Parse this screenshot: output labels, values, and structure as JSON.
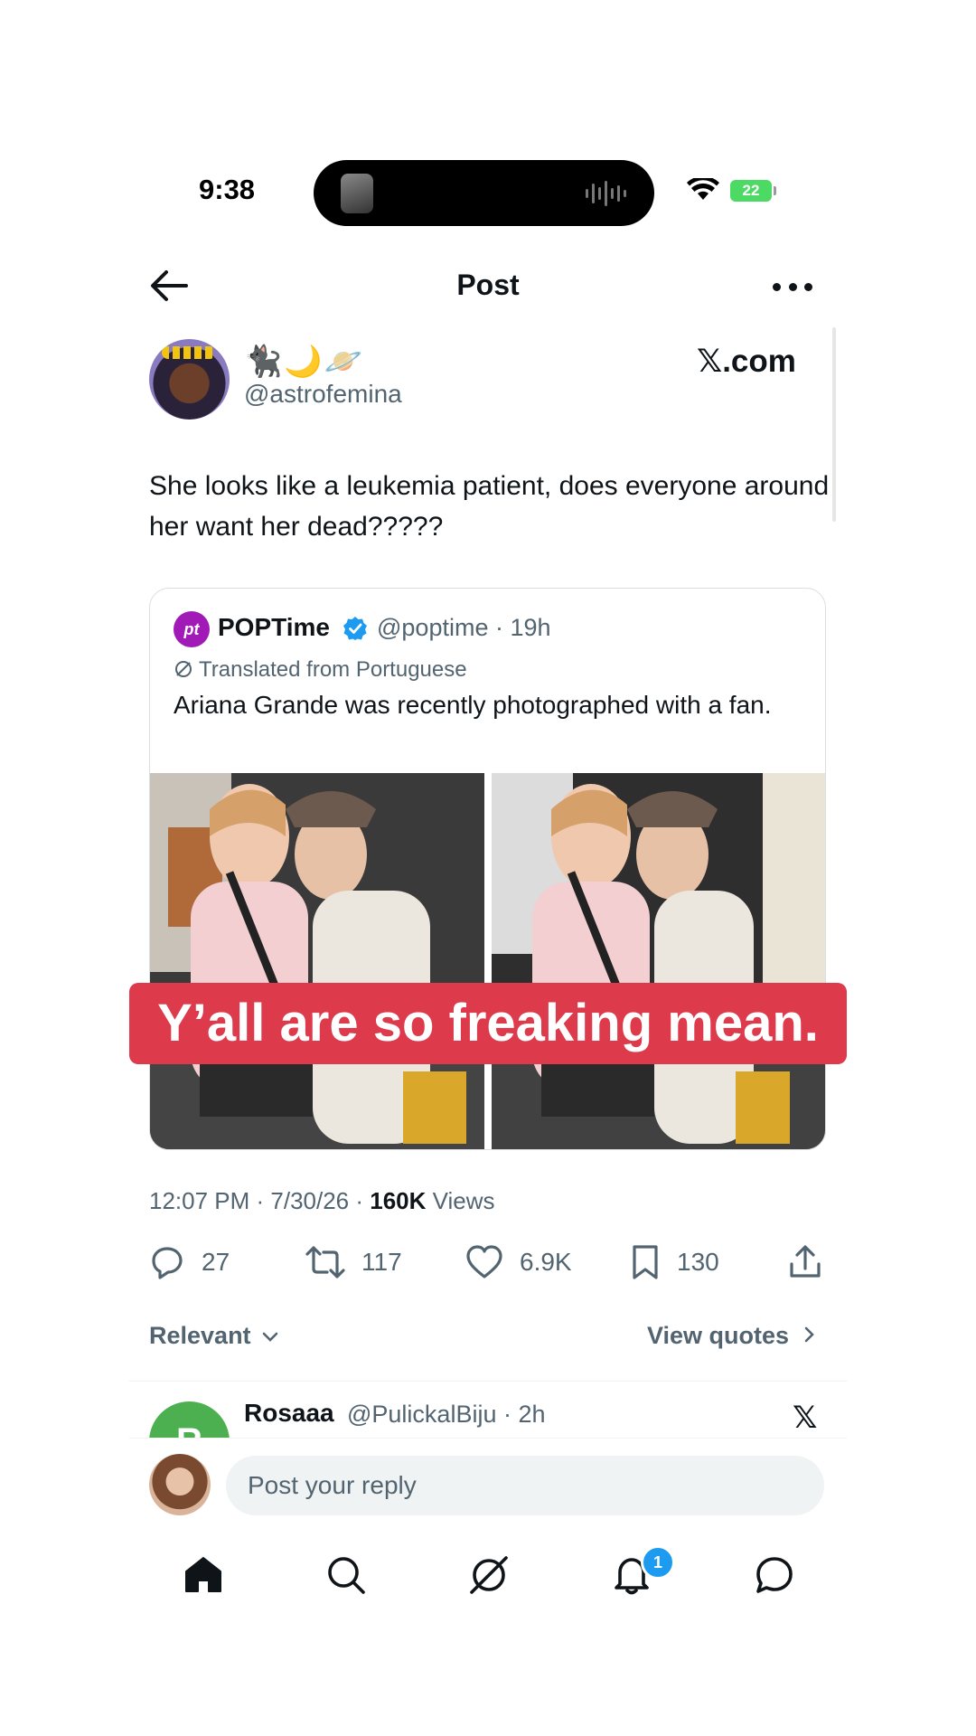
{
  "status_bar": {
    "time": "9:38",
    "battery": "22"
  },
  "header": {
    "title": "Post"
  },
  "post": {
    "author_name": "🐈‍⬛🌙🪐",
    "author_handle": "@astrofemina",
    "source": "𝕏.com",
    "text": "She looks like a leukemia patient, does everyone around her want her dead?????",
    "timestamp": "12:07 PM · 7/30/26 · ",
    "views_count": "160K",
    "views_label": " Views",
    "stats": {
      "replies": "27",
      "reposts": "117",
      "likes": "6.9K",
      "bookmarks": "130"
    }
  },
  "quote": {
    "logo_text": "pt",
    "name": "POPTime",
    "meta": "@poptime · 19h",
    "translated": "Translated from Portuguese",
    "text": "Ariana Grande was recently photographed with a fan."
  },
  "caption": "Y’all are so freaking mean.",
  "sort": {
    "relevant_label": "Relevant",
    "view_quotes_label": "View quotes"
  },
  "reply_preview": {
    "avatar_letter": "R",
    "name": "Rosaaa",
    "meta": "@PulickalBiju · 2h",
    "source_icon": "𝕏"
  },
  "compose": {
    "placeholder": "Post your reply"
  },
  "nav": {
    "notifications_badge": "1"
  },
  "colors": {
    "accent": "#1d9bf0",
    "caption_bg": "#dd3a4c",
    "pop_brand": "#a11ab8",
    "muted": "#536471"
  }
}
